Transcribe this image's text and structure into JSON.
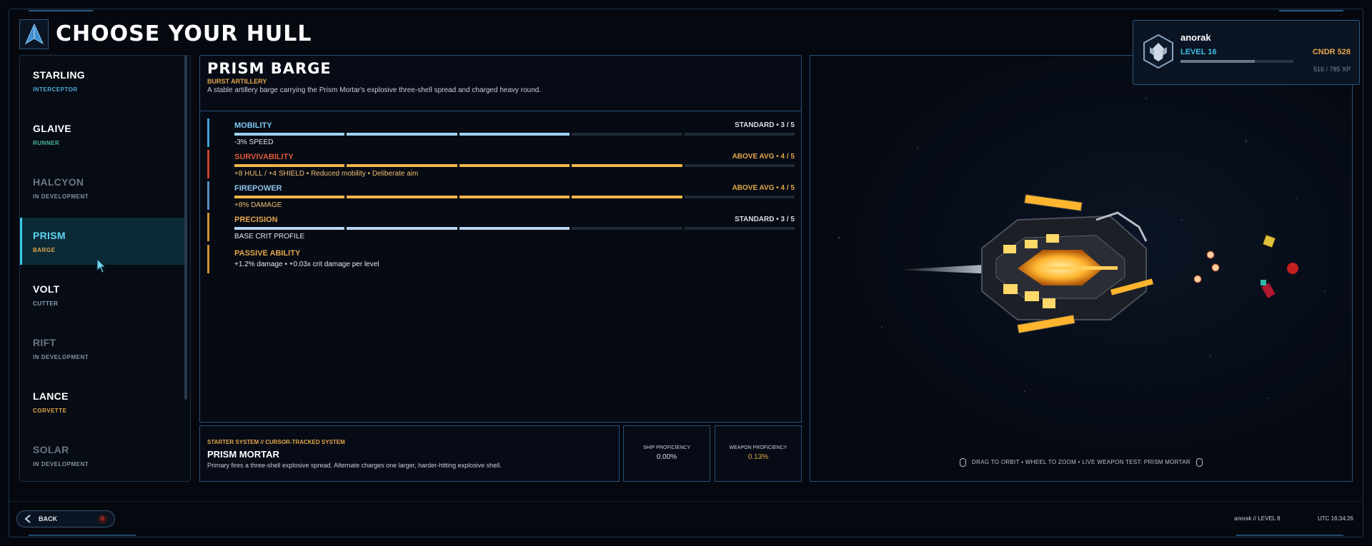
{
  "header": {
    "title": "CHOOSE YOUR HULL"
  },
  "hulls": [
    {
      "name": "STARLING",
      "class": "INTERCEPTOR",
      "class_color": "#4fa9d8",
      "state": "normal"
    },
    {
      "name": "GLAIVE",
      "class": "RUNNER",
      "class_color": "#49b8a2",
      "state": "normal"
    },
    {
      "name": "HALCYON",
      "class": "IN DEVELOPMENT",
      "class_color": "#8592a1",
      "state": "dev"
    },
    {
      "name": "PRISM",
      "class": "BARGE",
      "class_color": "#e6a74b",
      "state": "selected"
    },
    {
      "name": "VOLT",
      "class": "CUTTER",
      "class_color": "#8fa3ba",
      "state": "normal"
    },
    {
      "name": "RIFT",
      "class": "IN DEVELOPMENT",
      "class_color": "#8592a1",
      "state": "dev"
    },
    {
      "name": "LANCE",
      "class": "CORVETTE",
      "class_color": "#e6a74b",
      "state": "normal"
    },
    {
      "name": "SOLAR",
      "class": "IN DEVELOPMENT",
      "class_color": "#8592a1",
      "state": "dev"
    }
  ],
  "ship": {
    "name": "PRISM BARGE",
    "role": "BURST ARTILLERY",
    "description": "A stable artillery barge carrying the Prism Mortar's explosive three-shell spread and charged heavy round."
  },
  "stats": [
    {
      "label": "MOBILITY",
      "rating": "STANDARD  •  3 / 5",
      "value": 3,
      "max": 5,
      "sub": "-3% SPEED",
      "color": "#9fd0f5",
      "label_color": "#7ec8f0",
      "mark_color": "#3fa3d8",
      "sub_color": "white"
    },
    {
      "label": "SURVIVABILITY",
      "rating": "ABOVE AVG  •  4 / 5",
      "value": 4,
      "max": 5,
      "sub": "+8 HULL / +4 SHIELD  •  Reduced mobility  •  Deliberate aim",
      "color": "#f2b54a",
      "label_color": "#e05a3a",
      "mark_color": "#c7402b",
      "sub_color": "orange"
    },
    {
      "label": "FIREPOWER",
      "rating": "ABOVE AVG  •  4 / 5",
      "value": 4,
      "max": 5,
      "sub": "+8% DAMAGE",
      "color": "#f2b54a",
      "label_color": "#8fc3e8",
      "mark_color": "#5b8fc0",
      "sub_color": "orange"
    },
    {
      "label": "PRECISION",
      "rating": "STANDARD  •  3 / 5",
      "value": 3,
      "max": 5,
      "sub": "BASE CRIT PROFILE",
      "color": "#b8d4f0",
      "label_color": "#e6a74b",
      "mark_color": "#d09030",
      "sub_color": "white"
    }
  ],
  "passive": {
    "label": "PASSIVE ABILITY",
    "text": "+1.2% damage   •   +0.03x crit damage per level"
  },
  "starter": {
    "tag": "STARTER SYSTEM  //  CURSOR-TRACKED SYSTEM",
    "name": "PRISM MORTAR",
    "description": "Primary fires a three-shell explosive spread. Alternate charges one larger, harder-hitting explosive shell."
  },
  "proficiency": {
    "ship_label": "SHIP PROFICIENCY",
    "ship_value": "0.00%",
    "weapon_label": "WEAPON PROFICIENCY",
    "weapon_value": "0.13%"
  },
  "viewport": {
    "hint": "DRAG TO ORBIT  •  WHEEL TO ZOOM  •  LIVE WEAPON TEST: PRISM MORTAR"
  },
  "profile": {
    "username": "anorak",
    "level": "LEVEL 16",
    "cndr": "CNDR 528",
    "xp": "516 / 785 XP",
    "xp_fraction": 0.657
  },
  "footer": {
    "back_label": "BACK",
    "back_key": "B",
    "user_level": "anorak  //  LEVEL 8",
    "clock": "UTC 16:34:26"
  },
  "colors": {
    "accent": "#39c6e8",
    "orange": "#e6a74b",
    "panel_border": "#2b4f78"
  }
}
